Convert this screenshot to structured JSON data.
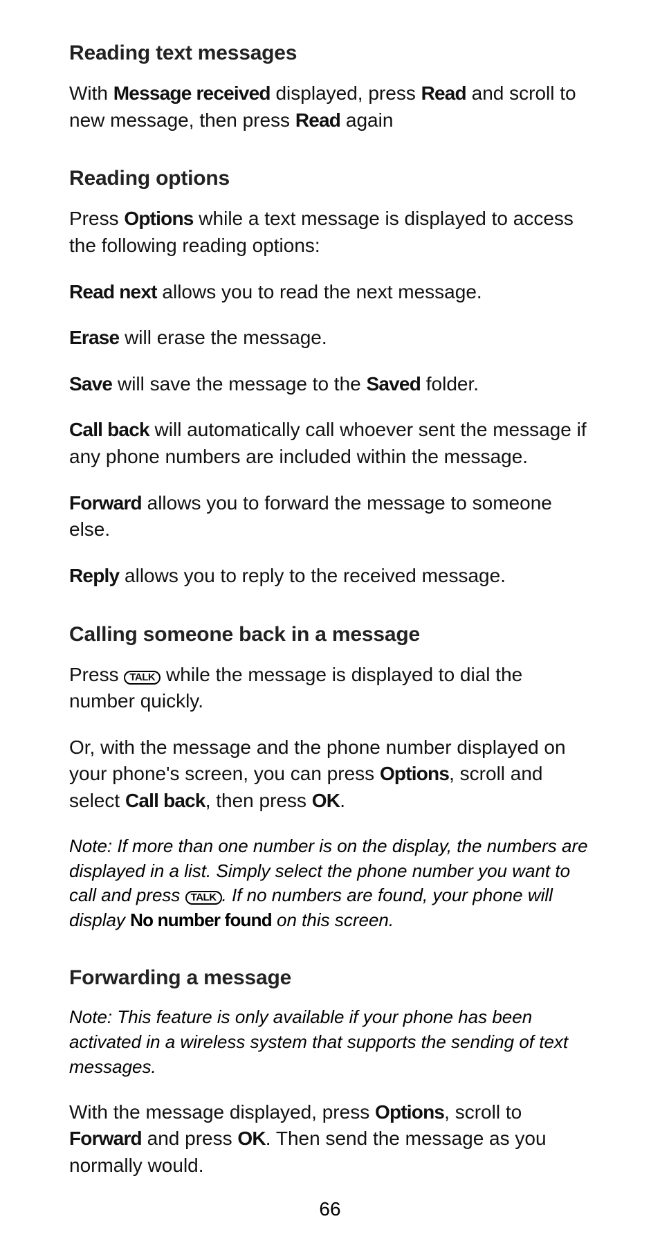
{
  "sections": {
    "reading_text": {
      "heading": "Reading text messages",
      "p1_before": "With ",
      "p1_b1": "Message received",
      "p1_mid1": " displayed, press ",
      "p1_b2": "Read",
      "p1_mid2": " and scroll to new message, then press ",
      "p1_b3": "Read",
      "p1_after": " again"
    },
    "reading_options": {
      "heading": "Reading options",
      "intro_before": "Press ",
      "intro_b": "Options",
      "intro_after": " while a text message is displayed to access the following reading options:",
      "rn_b": "Read next",
      "rn_after": " allows you to read the next message.",
      "erase_b": "Erase",
      "erase_after": " will erase the message.",
      "save_b": "Save",
      "save_mid": " will save the message to the ",
      "save_b2": "Saved",
      "save_after": " folder.",
      "cb_b": "Call back",
      "cb_after": " will automatically call whoever sent the message if any phone numbers are included within the message.",
      "fwd_b": "Forward",
      "fwd_after": " allows you to forward the message to someone else.",
      "reply_b": "Reply",
      "reply_after": " allows you to reply to the received message."
    },
    "call_back": {
      "heading": "Calling someone back in a message",
      "p1_before": "Press ",
      "talk": "TALK",
      "p1_after": " while the message is displayed to dial the number quickly.",
      "p2_before": "Or, with the message and the phone number displayed on your phone's screen, you can press ",
      "p2_b1": "Options",
      "p2_mid1": ", scroll and select ",
      "p2_b2": "Call back",
      "p2_mid2": ", then press ",
      "p2_b3": "OK",
      "p2_after": ".",
      "note_before": "Note: If more than one number is on the display, the numbers are displayed in a list. Simply select the phone number you want to call and press ",
      "note_mid": ". If no numbers are found, your phone will display ",
      "note_b": "No number found",
      "note_after": " on this screen."
    },
    "forwarding": {
      "heading": "Forwarding a message",
      "note": "Note: This feature is only available if your phone has been activated in a wireless system that supports the sending of text messages.",
      "p1_before": "With the message displayed, press ",
      "p1_b1": "Options",
      "p1_mid1": ", scroll to ",
      "p1_b2": "Forward",
      "p1_mid2": " and press ",
      "p1_b3": "OK",
      "p1_after": ".  Then send the message as you normally would."
    }
  },
  "page_number": "66"
}
